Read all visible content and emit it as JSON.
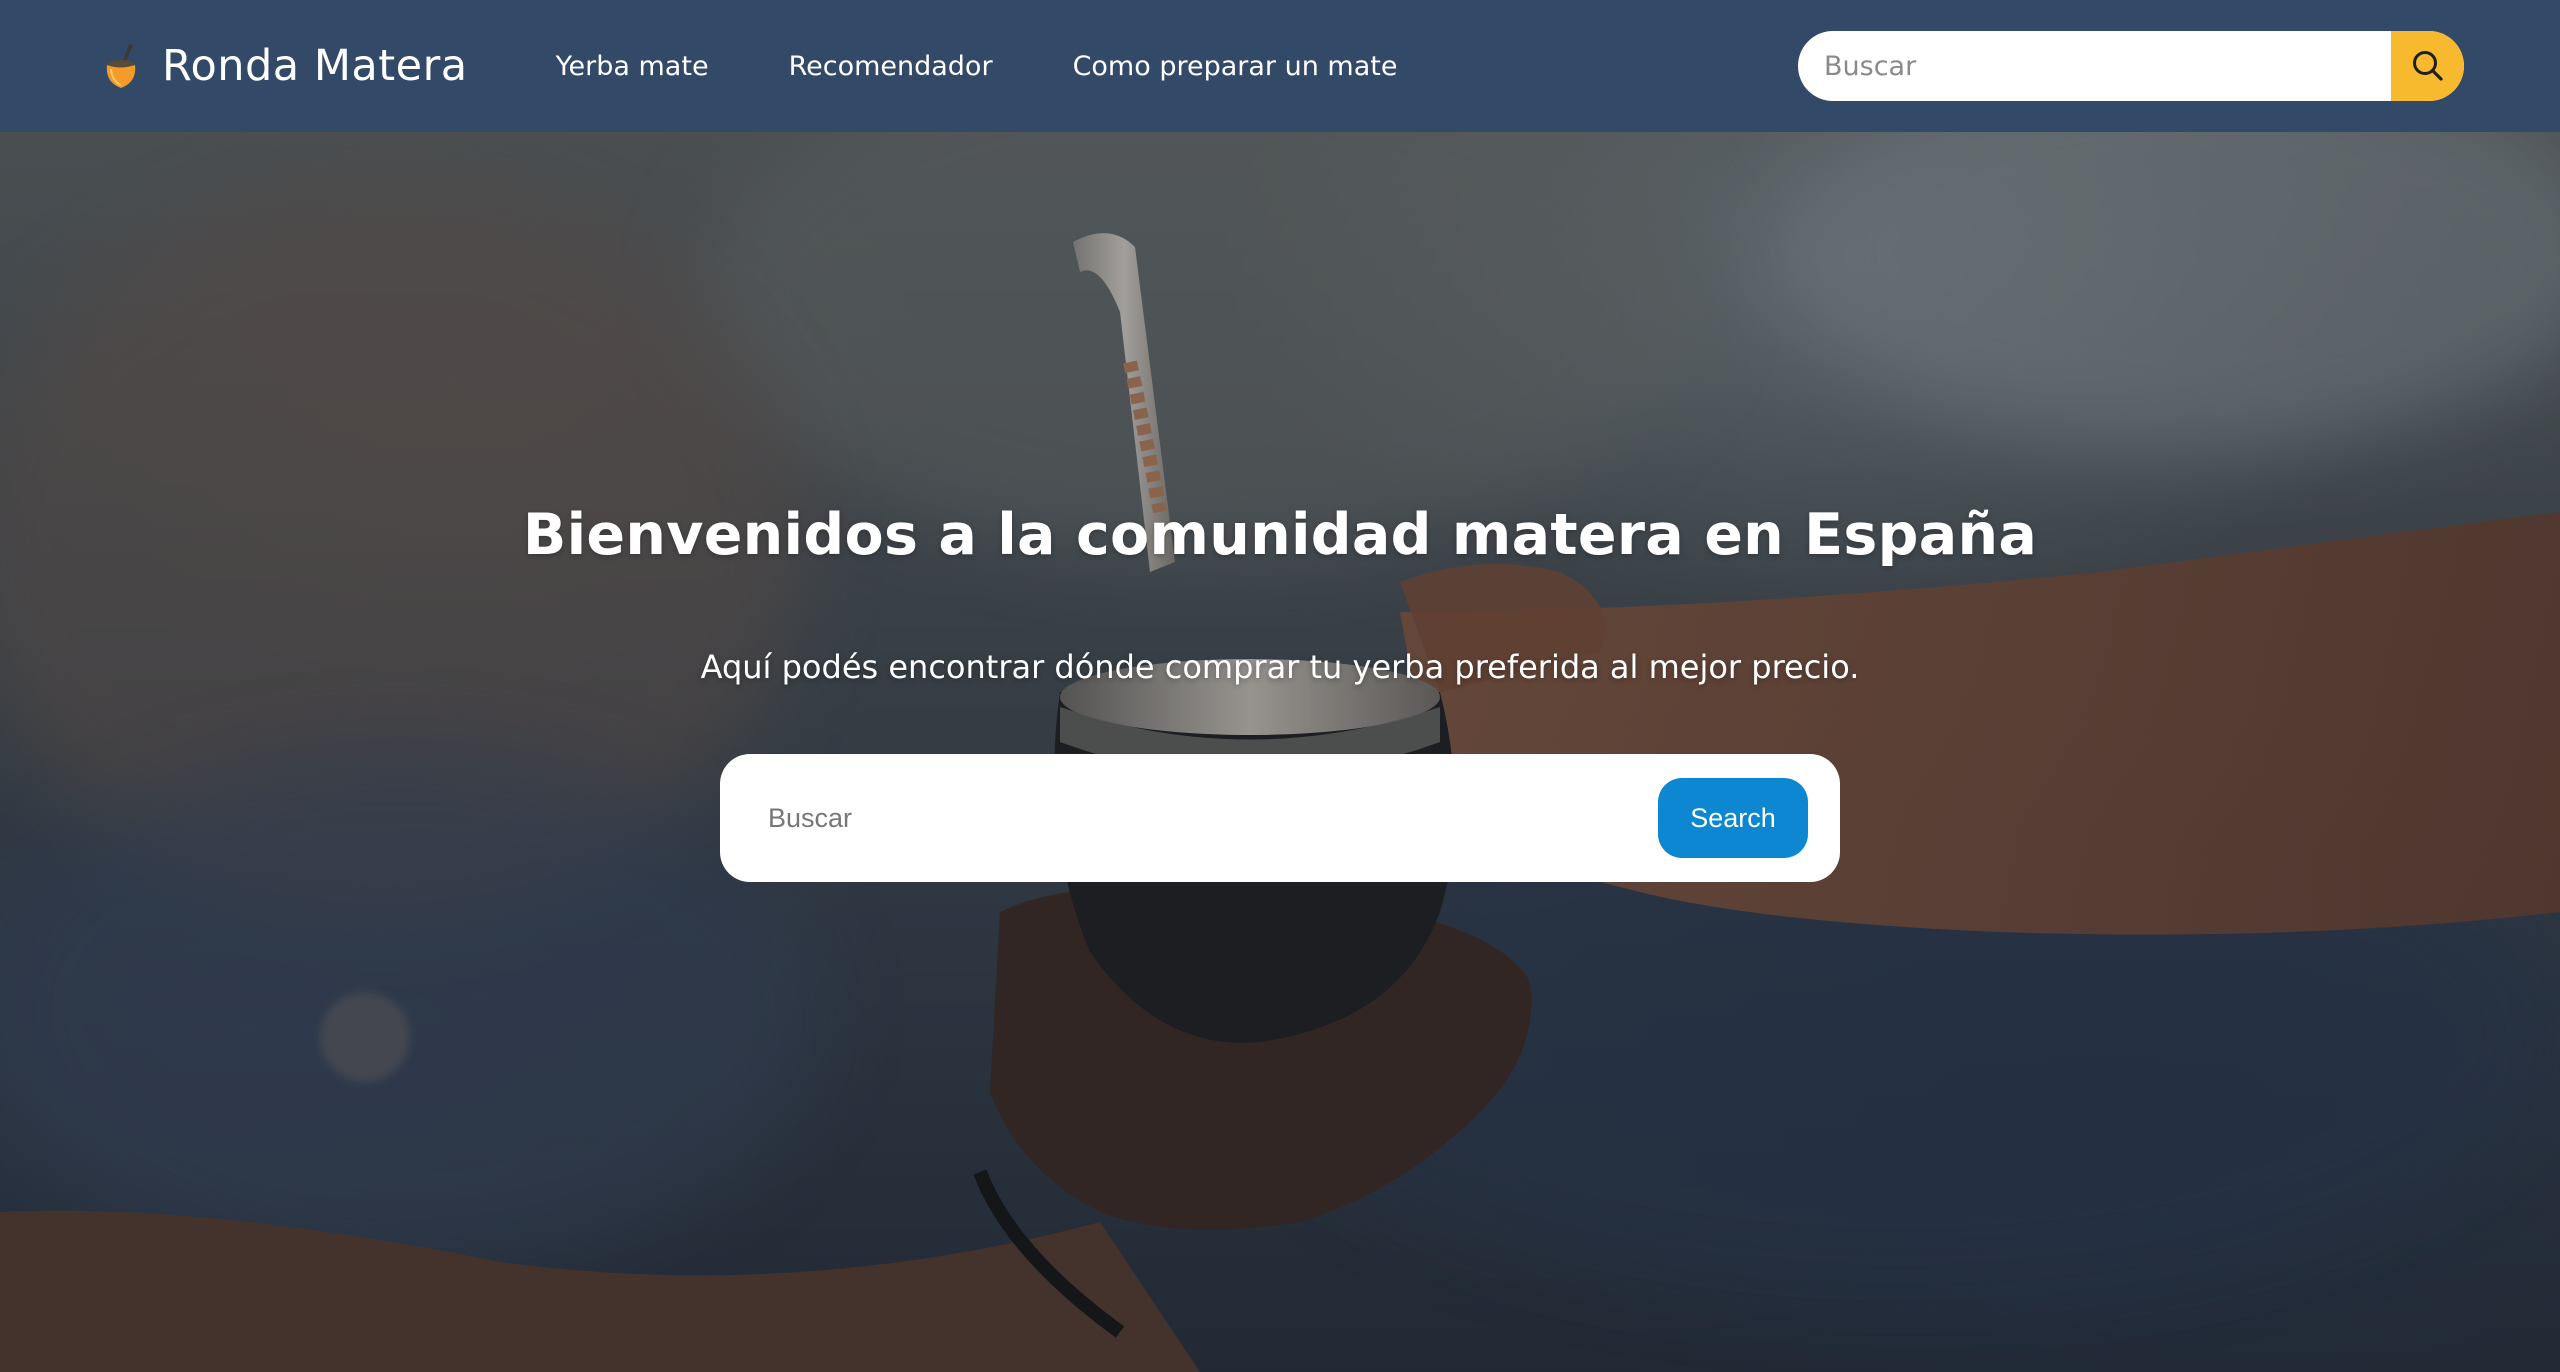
{
  "header": {
    "brand_name": "Ronda Matera",
    "logo_icon": "mate-gourd-icon",
    "nav": [
      {
        "label": "Yerba mate"
      },
      {
        "label": "Recomendador"
      },
      {
        "label": "Como preparar un mate"
      }
    ],
    "search": {
      "placeholder": "Buscar",
      "button_icon": "search-icon"
    }
  },
  "hero": {
    "title": "Bienvenidos a la comunidad matera en España",
    "subtitle": "Aquí podés encontrar dónde comprar tu yerba preferida al mejor precio.",
    "search": {
      "placeholder": "Buscar",
      "button_label": "Search"
    },
    "background": "mate-handoff-photo"
  },
  "colors": {
    "navbar": "#324968",
    "accent_yellow": "#f7b92d",
    "search_button_blue": "#0d87d1",
    "text_white": "#ffffff",
    "logo_orange": "#f39a2a"
  }
}
